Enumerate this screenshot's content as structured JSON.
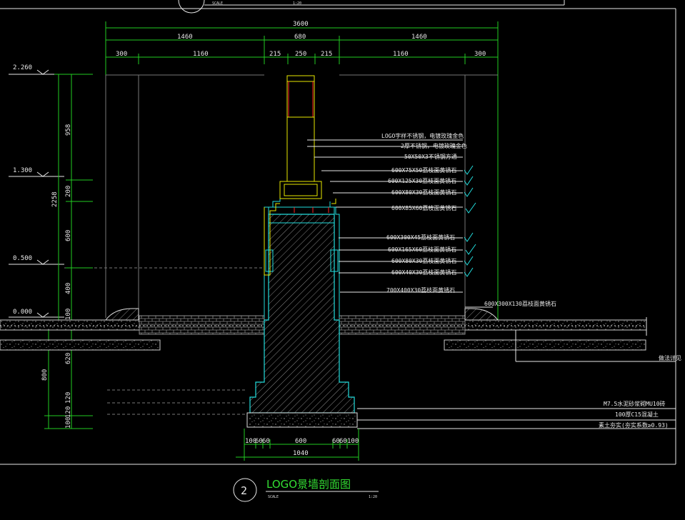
{
  "drawing": {
    "title": "LOGO景墙剖面图",
    "number": "2",
    "scale_label": "SCALE",
    "scale": "1:20",
    "top_stub_scale_label": "SCALE",
    "top_stub_scale": "1:20"
  },
  "dimensions": {
    "top_total": "3600",
    "top_mid": [
      "1460",
      "680",
      "1460"
    ],
    "top_detail": [
      "300",
      "1160",
      "215",
      "250",
      "215",
      "1160",
      "300"
    ],
    "left_total": "2258",
    "left_segments": [
      "958",
      "200",
      "600",
      "400",
      "100"
    ],
    "left_lower": [
      "800",
      "620",
      "120",
      "120",
      "100"
    ],
    "bottom_detail": [
      "100",
      "60",
      "60",
      "600",
      "60",
      "60",
      "100"
    ],
    "bottom_total": "1040"
  },
  "levels": [
    "2.260",
    "1.300",
    "0.500",
    "0.000"
  ],
  "annotations": [
    "LOGO字样不锈钢，电镀玫瑰金色",
    "2厚不锈钢，电镀玫瑰金色",
    "50X50X3不锈钢方通",
    "600X75X50荔枝面黄锈石",
    "600X125X30荔枝面黄锈石",
    "600X80X30荔枝面黄锈石",
    "600X85X60荔枝面黄锈石",
    "600X300X45荔枝面黄锈石",
    "600X165X60荔枝面黄锈石",
    "600X80X30荔枝面黄锈石",
    "600X40X30荔枝面黄锈石",
    "700X400X30荔枝面黄锈石",
    "600X300X130荔枝面黄锈石",
    "做法详见",
    "M7.5水泥砂浆砌MU10砖",
    "100厚C15混凝土",
    "素土夯实(夯实系数≥0.93)"
  ],
  "colors": {
    "background": "#000000",
    "dimension": "#22cc22",
    "structure": "#22dddd",
    "frame": "#e8e800",
    "accent": "#ff2222",
    "text": "#e8e8e8"
  }
}
